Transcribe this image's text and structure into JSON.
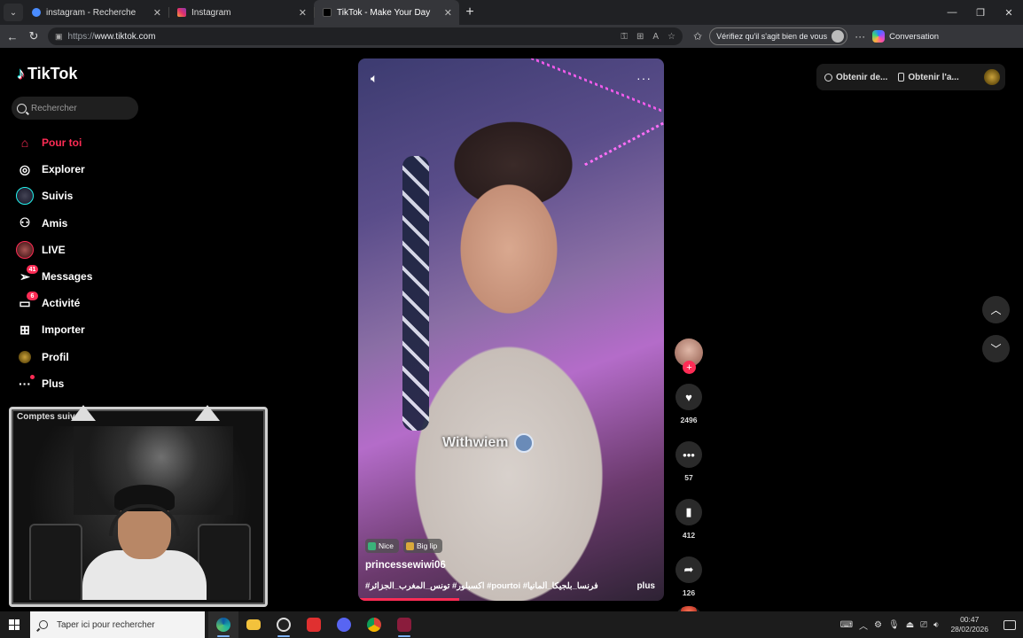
{
  "browser": {
    "tabs": [
      {
        "title": "instagram - Recherche",
        "icon": "search-icon",
        "active": false
      },
      {
        "title": "Instagram",
        "icon": "instagram-icon",
        "active": false
      },
      {
        "title": "TikTok - Make Your Day",
        "icon": "tiktok-icon",
        "active": true
      }
    ],
    "url_protocol": "https://",
    "url_host": "www.tiktok.com",
    "verify_label": "Vérifiez qu'il s'agit bien de vous",
    "copilot_label": "Conversation"
  },
  "sidebar": {
    "brand": "TikTok",
    "search_placeholder": "Rechercher",
    "nav": [
      {
        "label": "Pour toi",
        "icon": "home-icon",
        "active": true
      },
      {
        "label": "Explorer",
        "icon": "compass-icon"
      },
      {
        "label": "Suivis",
        "icon": "following-icon"
      },
      {
        "label": "Amis",
        "icon": "friends-icon"
      },
      {
        "label": "LIVE",
        "icon": "live-icon"
      },
      {
        "label": "Messages",
        "icon": "messages-icon",
        "badge": "41"
      },
      {
        "label": "Activité",
        "icon": "activity-icon",
        "badge": "6"
      },
      {
        "label": "Importer",
        "icon": "upload-icon"
      },
      {
        "label": "Profil",
        "icon": "profile-icon"
      },
      {
        "label": "Plus",
        "icon": "more-dots-icon",
        "dot": true
      }
    ],
    "followed_title": "Comptes suiv"
  },
  "video": {
    "watermark": "Withwiem",
    "tags": [
      {
        "label": "Nice",
        "color": "#3bb27a"
      },
      {
        "label": "Big lip",
        "color": "#d9a93b"
      }
    ],
    "author": "princessewiwi06",
    "caption": "#اكسبلور# تونس_المغرب_الجزائر #pourtoi #فرنسا_بلجيكا_ألمانيا",
    "more_label": "plus",
    "progress": 0.33
  },
  "actions": {
    "likes": "2496",
    "comments": "57",
    "saves": "412",
    "shares": "126"
  },
  "top_widget": {
    "item1": "Obtenir de...",
    "item2": "Obtenir l'a..."
  },
  "taskbar": {
    "search_placeholder": "Taper ici pour rechercher",
    "time": "00:47",
    "date": "28/02/2026"
  },
  "colors": {
    "accent": "#fe2c55",
    "background": "#000000"
  }
}
